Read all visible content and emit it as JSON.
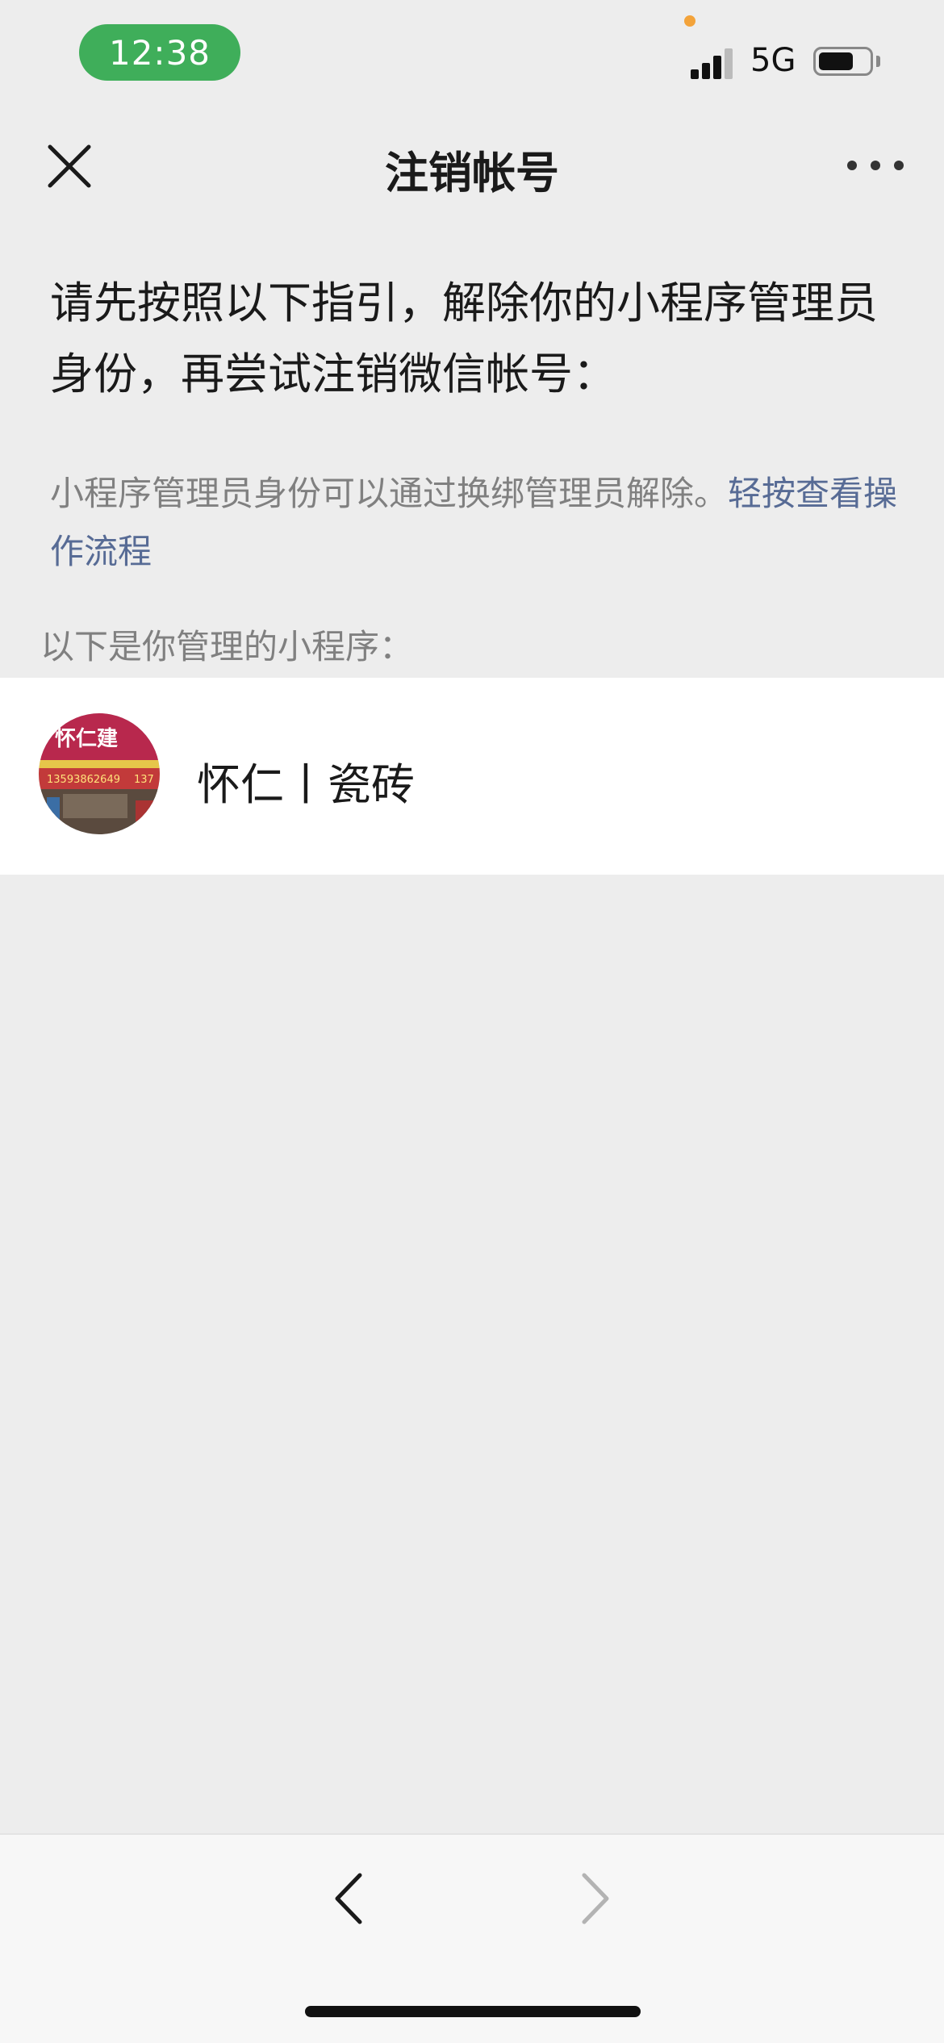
{
  "status_bar": {
    "time": "12:38",
    "network": "5G"
  },
  "nav": {
    "title": "注销帐号",
    "close_icon": "close-icon",
    "more_icon": "more-icon"
  },
  "content": {
    "heading": "请先按照以下指引，解除你的小程序管理员身份，再尝试注销微信帐号：",
    "description": "小程序管理员身份可以通过换绑管理员解除。",
    "link_text": "轻按查看操作流程",
    "section_label": "以下是你管理的小程序："
  },
  "mini_programs": [
    {
      "name": "怀仁丨瓷砖"
    }
  ],
  "avatar_sign": {
    "main": "怀仁建",
    "sub": "13593862649",
    "sub2": "137"
  },
  "toolbar": {
    "back_icon": "chevron-left-icon",
    "forward_icon": "chevron-right-icon"
  },
  "colors": {
    "background": "#ededed",
    "card": "#ffffff",
    "link": "#576b95",
    "time_pill": "#3fae5a",
    "secondary_text": "#808080"
  }
}
